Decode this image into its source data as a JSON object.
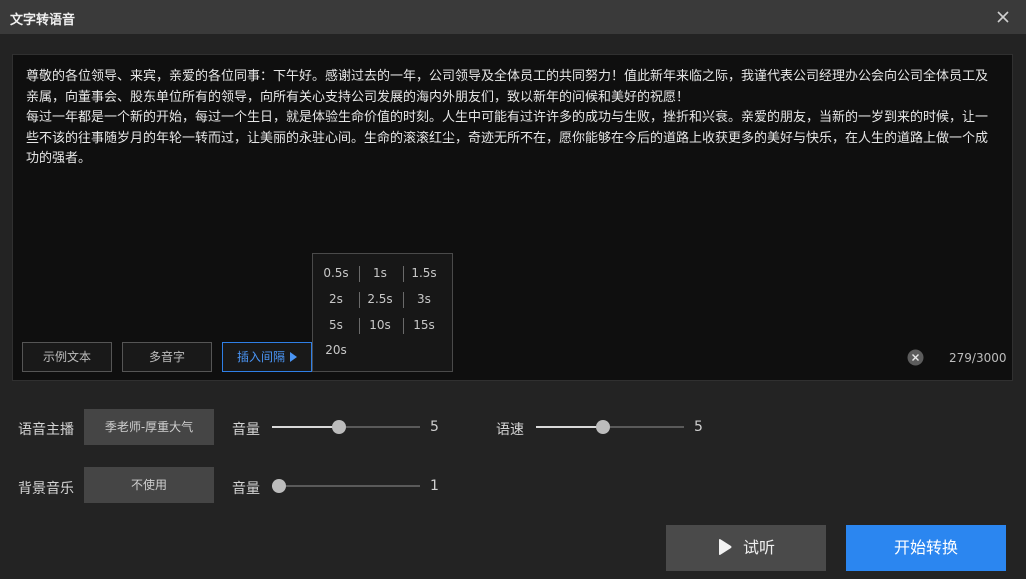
{
  "window": {
    "title": "文字转语音"
  },
  "editor": {
    "text": "尊敬的各位领导、来宾，亲爱的各位同事：下午好。感谢过去的一年，公司领导及全体员工的共同努力！值此新年来临之际，我谨代表公司经理办公会向公司全体员工及亲属，向董事会、股东单位所有的领导，向所有关心支持公司发展的海内外朋友们，致以新年的问候和美好的祝愿！\n每过一年都是一个新的开始，每过一个生日，就是体验生命价值的时刻。人生中可能有过许许多的成功与生败，挫折和兴衰。亲爱的朋友，当新的一岁到来的时候，让一些不该的往事随岁月的年轮一转而过，让美丽的永驻心间。生命的滚滚红尘，奇迹无所不在，愿你能够在今后的道路上收获更多的美好与快乐，在人生的道路上做一个成功的强者。",
    "counter": "279/3000",
    "buttons": {
      "sample": "示例文本",
      "polyphone": "多音字",
      "insert_pause": "插入间隔"
    }
  },
  "pause_menu": {
    "options": [
      "0.5s",
      "1s",
      "1.5s",
      "2s",
      "2.5s",
      "3s",
      "5s",
      "10s",
      "15s",
      "20s"
    ]
  },
  "voice": {
    "label": "语音主播",
    "selected": "季老师-厚重大气",
    "volume_label": "音量",
    "volume": 5,
    "volume_max": 10,
    "speed_label": "语速",
    "speed": 5,
    "speed_max": 10
  },
  "bgm": {
    "label": "背景音乐",
    "selected": "不使用",
    "volume_label": "音量",
    "volume": 1,
    "volume_max": 10
  },
  "actions": {
    "listen": "试听",
    "convert": "开始转换"
  },
  "colors": {
    "accent": "#2b86f0"
  }
}
